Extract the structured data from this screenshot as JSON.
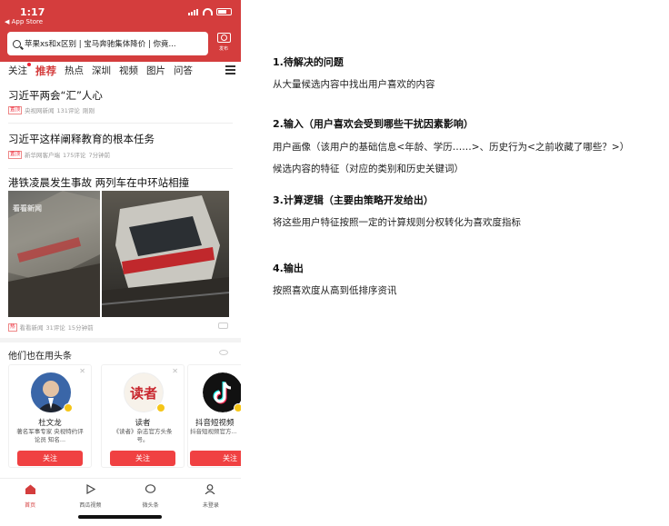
{
  "status_bar": {
    "time": "1:17",
    "back_app": "◀ App Store"
  },
  "search": {
    "query": "苹果xs和x区别 | 宝马奔驰集体降价 | 你竟...",
    "camera_label": "发布"
  },
  "tabs": [
    "关注",
    "推荐",
    "热点",
    "深圳",
    "视频",
    "图片",
    "问答"
  ],
  "active_tab": "推荐",
  "feed": [
    {
      "title": "习近平两会“汇”人心",
      "tag": "置顶",
      "source": "央视网新闻",
      "comments": "131评论",
      "time": "刚刚"
    },
    {
      "title": "习近平这样阐释教育的根本任务",
      "tag": "置顶",
      "source": "新华网客户端",
      "comments": "175评论",
      "time": "7分钟前"
    },
    {
      "title": "港铁凌晨发生事故 两列车在中环站相撞",
      "tag": "热",
      "source": "看看新闻",
      "comments": "31评论",
      "time": "15分钟前",
      "watermark": "看看新闻"
    }
  ],
  "recommend": {
    "title": "他们也在用头条",
    "cards": [
      {
        "name": "杜文龙",
        "desc": "著名军事专家 央视特约评论员 知名...",
        "follow": "关注",
        "avatar": "person-avatar"
      },
      {
        "name": "读者",
        "desc": "《读者》杂志官方头条号。",
        "follow": "关注",
        "avatar": "duzhe-logo",
        "logo_text": "读者"
      },
      {
        "name": "抖音短视频",
        "desc": "抖音短视频官方...",
        "follow": "关注",
        "avatar": "tiktok-logo"
      }
    ]
  },
  "bottom_nav": [
    {
      "label": "首页",
      "icon": "home-icon",
      "active": true
    },
    {
      "label": "西瓜视频",
      "icon": "play-icon",
      "active": false
    },
    {
      "label": "微头条",
      "icon": "bubble-icon",
      "active": false
    },
    {
      "label": "未登录",
      "icon": "user-icon",
      "active": false
    }
  ],
  "doc": {
    "s1_title": "1.待解决的问题",
    "s1_body": "从大量候选内容中找出用户喜欢的内容",
    "s2_title": "2.输入（用户喜欢会受到哪些干扰因素影响）",
    "s2_body1": "用户画像（该用户的基础信息<年龄、学历……>、历史行为<之前收藏了哪些？>）",
    "s2_body2": "候选内容的特征（对应的类别和历史关键词）",
    "s3_title": "3.计算逻辑（主要由策略开发给出）",
    "s3_body": "将这些用户特征按照一定的计算规则分权转化为喜欢度指标",
    "s4_title": "4.输出",
    "s4_body": "按照喜欢度从高到低排序资讯"
  },
  "colors": {
    "brand_red": "#d43d3d",
    "follow_red": "#f04142"
  }
}
